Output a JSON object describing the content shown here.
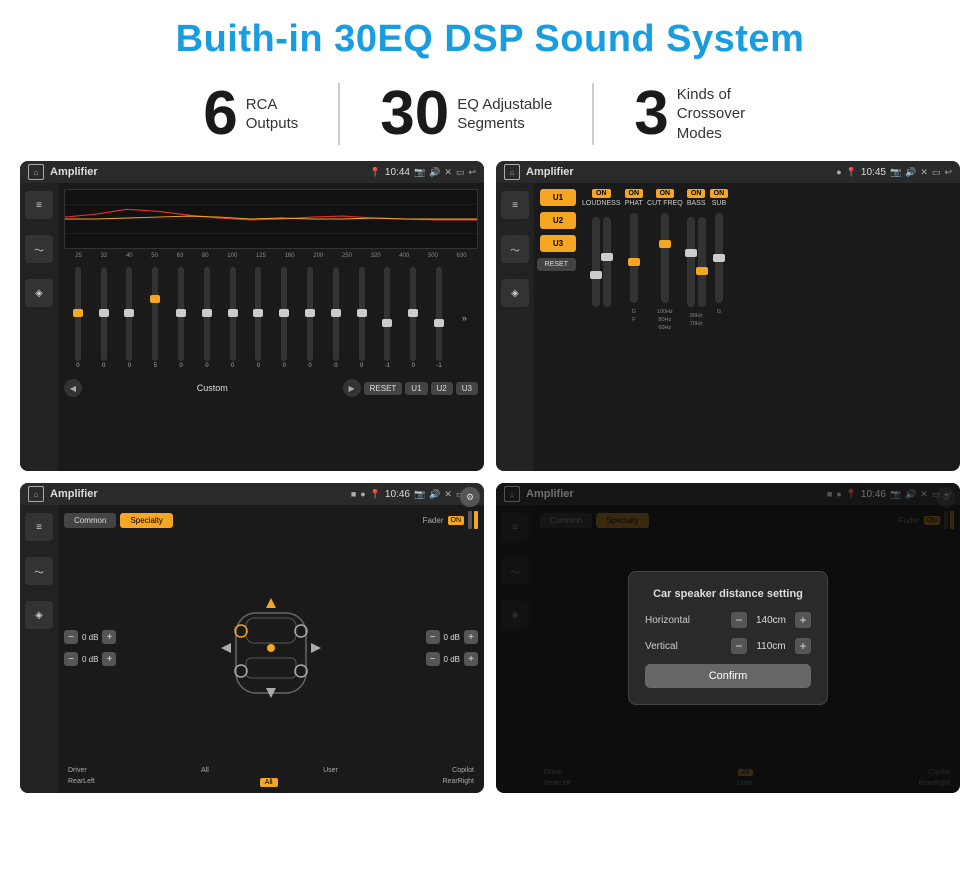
{
  "title": "Buith-in 30EQ DSP Sound System",
  "stats": [
    {
      "number": "6",
      "label": "RCA\nOutputs"
    },
    {
      "number": "30",
      "label": "EQ Adjustable\nSegments"
    },
    {
      "number": "3",
      "label": "Kinds of\nCrossover Modes"
    }
  ],
  "screens": [
    {
      "id": "screen-eq",
      "title": "Amplifier",
      "time": "10:44",
      "type": "eq"
    },
    {
      "id": "screen-crossover",
      "title": "Amplifier",
      "time": "10:45",
      "type": "crossover"
    },
    {
      "id": "screen-speaker",
      "title": "Amplifier",
      "time": "10:46",
      "type": "speaker"
    },
    {
      "id": "screen-dialog",
      "title": "Amplifier",
      "time": "10:46",
      "type": "dialog"
    }
  ],
  "eq": {
    "frequencies": [
      "25",
      "32",
      "40",
      "50",
      "63",
      "80",
      "100",
      "125",
      "160",
      "200",
      "250",
      "320",
      "400",
      "500",
      "630"
    ],
    "values": [
      "0",
      "0",
      "0",
      "5",
      "0",
      "0",
      "0",
      "0",
      "0",
      "0",
      "0",
      "0",
      "-1",
      "0",
      "-1"
    ],
    "preset": "Custom",
    "buttons": [
      "RESET",
      "U1",
      "U2",
      "U3"
    ]
  },
  "crossover": {
    "presets": [
      "U1",
      "U2",
      "U3"
    ],
    "columns": [
      "LOUDNESS",
      "PHAT",
      "CUT FREQ",
      "BASS",
      "SUB"
    ],
    "resetLabel": "RESET"
  },
  "speaker": {
    "tabs": [
      "Common",
      "Specialty"
    ],
    "faderLabel": "Fader",
    "labels": [
      "Driver",
      "Copilot",
      "RearLeft",
      "All",
      "User",
      "RearRight"
    ],
    "dbValues": [
      "0 dB",
      "0 dB",
      "0 dB",
      "0 dB"
    ]
  },
  "dialog": {
    "title": "Car speaker distance setting",
    "horizontal": {
      "label": "Horizontal",
      "value": "140cm"
    },
    "vertical": {
      "label": "Vertical",
      "value": "110cm"
    },
    "confirmLabel": "Confirm"
  }
}
